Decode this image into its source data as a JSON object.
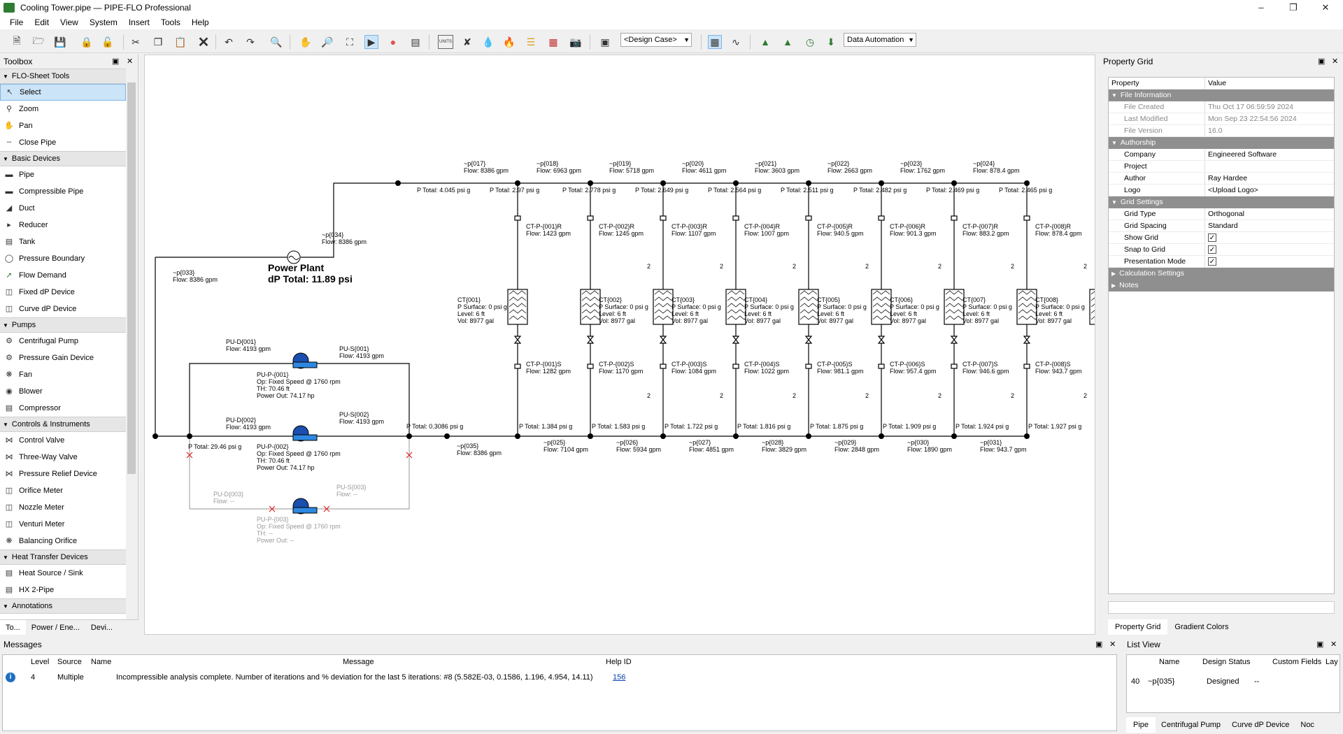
{
  "window": {
    "title": "Cooling Tower.pipe — PIPE-FLO Professional",
    "app_icon": "PIPE-FLO"
  },
  "menu": [
    "File",
    "Edit",
    "View",
    "System",
    "Insert",
    "Tools",
    "Help"
  ],
  "toolbar": {
    "design_case": "<Design Case>",
    "data_automation": "Data Automation",
    "units_label": "UNITS"
  },
  "toolbox": {
    "title": "Toolbox",
    "groups": [
      {
        "label": "FLO-Sheet Tools",
        "items": [
          "Select",
          "Zoom",
          "Pan",
          "Close Pipe"
        ]
      },
      {
        "label": "Basic Devices",
        "items": [
          "Pipe",
          "Compressible Pipe",
          "Duct",
          "Reducer",
          "Tank",
          "Pressure Boundary",
          "Flow Demand",
          "Fixed dP Device",
          "Curve dP Device"
        ]
      },
      {
        "label": "Pumps",
        "items": [
          "Centrifugal Pump",
          "Pressure Gain Device",
          "Fan",
          "Blower",
          "Compressor"
        ]
      },
      {
        "label": "Controls & Instruments",
        "items": [
          "Control Valve",
          "Three-Way Valve",
          "Pressure Relief Device",
          "Orifice Meter",
          "Nozzle Meter",
          "Venturi Meter",
          "Balancing Orifice"
        ]
      },
      {
        "label": "Heat Transfer Devices",
        "items": [
          "Heat Source / Sink",
          "HX 2-Pipe"
        ]
      },
      {
        "label": "Annotations",
        "items": []
      }
    ],
    "tabs": [
      "To...",
      "Power / Ene...",
      "Devi..."
    ]
  },
  "canvas": {
    "power_plant": {
      "title": "Power Plant",
      "dp": "dP Total: 11.89 psi"
    },
    "labels": {
      "p017": "~p{017}",
      "f017": "Flow: 8386 gpm",
      "p018": "~p{018}",
      "f018": "Flow: 6963 gpm",
      "p019": "~p{019}",
      "f019": "Flow: 5718 gpm",
      "p020": "~p{020}",
      "f020": "Flow: 4611 gpm",
      "p021": "~p{021}",
      "f021": "Flow: 3603 gpm",
      "p022": "~p{022}",
      "f022": "Flow: 2663 gpm",
      "p023": "~p{023}",
      "f023": "Flow: 1762 gpm",
      "p024": "~p{024}",
      "f024": "Flow: 878.4 gpm",
      "pt1": "P Total: 4.045 psi g",
      "pt2": "P Total: 2.97 psi g",
      "pt3": "P Total: 2.778 psi g",
      "pt4": "P Total: 2.649 psi g",
      "pt5": "P Total: 2.564 psi g",
      "pt6": "P Total: 2.511 psi g",
      "pt7": "P Total: 2.482 psi g",
      "pt8": "P Total: 2.469 psi g",
      "pt9": "P Total: 2.465 psi g",
      "p034": "~p{034}",
      "f034": "Flow: 8386 gpm",
      "p033": "~p{033}",
      "f033": "Flow: 8386 gpm",
      "ctr1": "CT-P-{001}R",
      "ctr1f": "Flow: 1423 gpm",
      "ctr2": "CT-P-{002}R",
      "ctr2f": "Flow: 1245 gpm",
      "ctr3": "CT-P-{003}R",
      "ctr3f": "Flow: 1107 gpm",
      "ctr4": "CT-P-{004}R",
      "ctr4f": "Flow: 1007 gpm",
      "ctr5": "CT-P-{005}R",
      "ctr5f": "Flow: 940.5 gpm",
      "ctr6": "CT-P-{006}R",
      "ctr6f": "Flow: 901.3 gpm",
      "ctr7": "CT-P-{007}R",
      "ctr7f": "Flow: 883.2 gpm",
      "ctr8": "CT-P-{008}R",
      "ctr8f": "Flow: 878.4 gpm",
      "ct_surface": "P Surface: 0 psi g",
      "ct_level": "Level: 6 ft",
      "ct_vol": "Vol: 8977 gal",
      "ct1": "CT{001}",
      "ct2": "CT{002}",
      "ct3": "CT{003}",
      "ct4": "CT{004}",
      "ct5": "CT{005}",
      "ct6": "CT{006}",
      "ct7": "CT{007}",
      "ct8": "CT{008}",
      "cts1": "CT-P-{001}S",
      "cts1f": "Flow: 1282 gpm",
      "cts2": "CT-P-{002}S",
      "cts2f": "Flow: 1170 gpm",
      "cts3": "CT-P-{003}S",
      "cts3f": "Flow: 1084 gpm",
      "cts4": "CT-P-{004}S",
      "cts4f": "Flow: 1022 gpm",
      "cts5": "CT-P-{005}S",
      "cts5f": "Flow: 981.1 gpm",
      "cts6": "CT-P-{006}S",
      "cts6f": "Flow: 957.4 gpm",
      "cts7": "CT-P-{007}S",
      "cts7f": "Flow: 946.6 gpm",
      "cts8": "CT-P-{008}S",
      "cts8f": "Flow: 943.7 gpm",
      "two": "2",
      "bpt0": "P Total: 0.3086 psi g",
      "bpt1": "P Total: 1.384 psi g",
      "bpt2": "P Total: 1.583 psi g",
      "bpt3": "P Total: 1.722 psi g",
      "bpt4": "P Total: 1.816 psi g",
      "bpt5": "P Total: 1.875 psi g",
      "bpt6": "P Total: 1.909 psi g",
      "bpt7": "P Total: 1.924 psi g",
      "bpt8": "P Total: 1.927 psi g",
      "p035": "~p{035}",
      "f035": "Flow: 8386 gpm",
      "p025": "~p{025}",
      "f025": "Flow: 7104 gpm",
      "p026": "~p{026}",
      "f026": "Flow: 5934 gpm",
      "p027": "~p{027}",
      "f027": "Flow: 4851 gpm",
      "p028": "~p{028}",
      "f028": "Flow: 3829 gpm",
      "p029": "~p{029}",
      "f029": "Flow: 2848 gpm",
      "p030": "~p{030}",
      "f030": "Flow: 1890 gpm",
      "p031": "~p{031}",
      "f031": "Flow: 943.7 gpm",
      "pud1": "PU-D{001}",
      "pud1f": "Flow: 4193 gpm",
      "pus1": "PU-S{001}",
      "pus1f": "Flow: 4193 gpm",
      "pup1": "PU-P-{001}",
      "pup1op": "Op: Fixed Speed @ 1760 rpm",
      "pup1th": "TH: 70.46 ft",
      "pup1po": "Power Out: 74.17 hp",
      "pud2": "PU-D{002}",
      "pud2f": "Flow: 4193 gpm",
      "pus2": "PU-S{002}",
      "pus2f": "Flow: 4193 gpm",
      "pup2": "PU-P-{002}",
      "pup2op": "Op: Fixed Speed @ 1760 rpm",
      "pup2th": "TH: 70.46 ft",
      "pup2po": "Power Out: 74.17 hp",
      "ptpump": "P Total: 29.46 psi g",
      "pud3": "PU-D{003}",
      "pud3f": "Flow: --",
      "pus3": "PU-S{003}",
      "pus3f": "Flow: --",
      "pup3": "PU-P-{003}",
      "pup3op": "Op: Fixed Speed @ 1760 rpm",
      "pup3th": "TH: --",
      "pup3po": "Power Out: --"
    }
  },
  "property_grid": {
    "title": "Property Grid",
    "header": {
      "k": "Property",
      "v": "Value"
    },
    "file_info": {
      "cat": "File Information",
      "created_k": "File Created",
      "created_v": "Thu Oct 17 06:59:59 2024",
      "modified_k": "Last Modified",
      "modified_v": "Mon Sep 23 22:54:56 2024",
      "version_k": "File Version",
      "version_v": "16.0"
    },
    "authorship": {
      "cat": "Authorship",
      "company_k": "Company",
      "company_v": "Engineered Software",
      "project_k": "Project",
      "project_v": "",
      "author_k": "Author",
      "author_v": "Ray Hardee",
      "logo_k": "Logo",
      "logo_v": "<Upload Logo>"
    },
    "grid": {
      "cat": "Grid Settings",
      "type_k": "Grid Type",
      "type_v": "Orthogonal",
      "spacing_k": "Grid Spacing",
      "spacing_v": "Standard",
      "show_k": "Show Grid",
      "snap_k": "Snap to Grid",
      "pres_k": "Presentation Mode"
    },
    "calc": "Calculation Settings",
    "notes": "Notes",
    "tabs": [
      "Property Grid",
      "Gradient Colors"
    ]
  },
  "messages": {
    "title": "Messages",
    "cols": {
      "level": "Level",
      "source": "Source",
      "name": "Name",
      "message": "Message",
      "help": "Help ID"
    },
    "row": {
      "level": "4",
      "source": "Multiple",
      "name": "",
      "message": "Incompressible analysis complete. Number of iterations and % deviation for the last 5 iterations: #8 (5.582E-03, 0.1586, 1.196, 4.954, 14.11)",
      "help": "156"
    }
  },
  "list_view": {
    "title": "List View",
    "cols": {
      "name": "Name",
      "status": "Design Status",
      "custom": "Custom Fields",
      "layer": "Lay"
    },
    "row": {
      "num": "40",
      "name": "~p{035}",
      "status": "Designed",
      "custom": "--"
    },
    "tabs": [
      "Pipe",
      "Centrifugal Pump",
      "Curve dP Device",
      "Noc"
    ]
  }
}
